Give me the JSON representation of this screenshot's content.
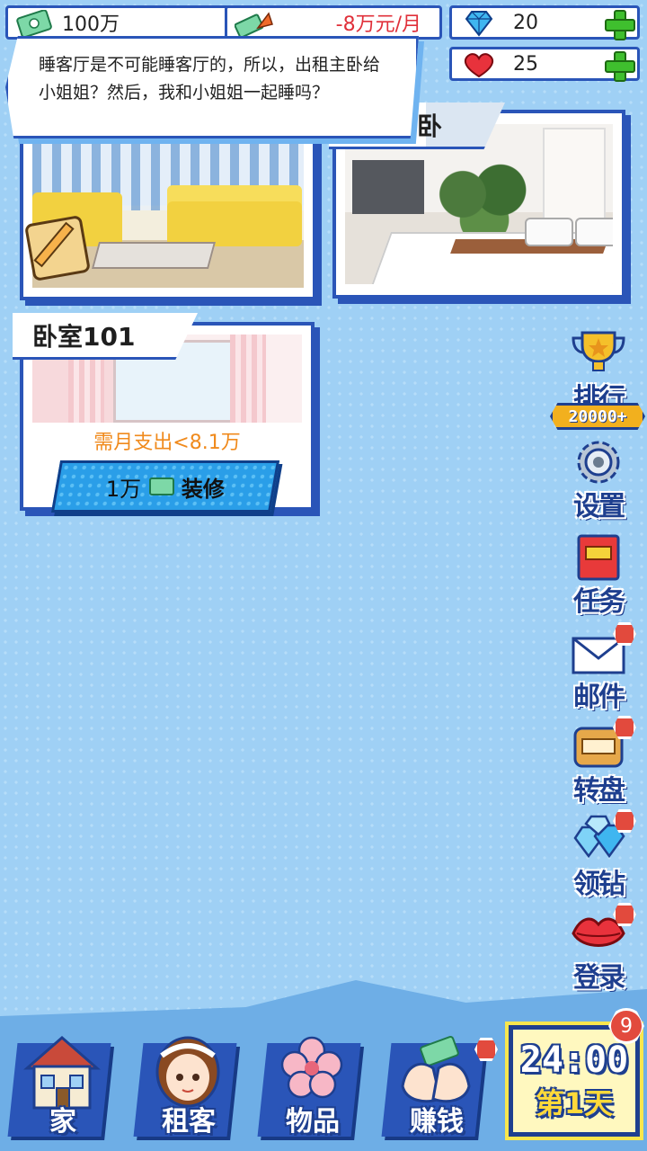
{
  "resources": {
    "money": "100万",
    "income": "-8万元/月",
    "diamonds": "20",
    "hearts": "25"
  },
  "dialog": {
    "text": "睡客厅是不可能睡客厅的，所以，出租主卧给小姐姐？然后，我和小姐姐一起睡吗？"
  },
  "rooms": {
    "living": {
      "label": ""
    },
    "master": {
      "label": "主卧"
    },
    "bedroom101": {
      "label": "卧室101",
      "expense": "需月支出<8.1万",
      "decorate_cost": "1万",
      "decorate_action": "装修"
    }
  },
  "side_menu": {
    "ranking": {
      "label": "排行",
      "sub": "20000+"
    },
    "settings": {
      "label": "设置"
    },
    "tasks": {
      "label": "任务"
    },
    "mail": {
      "label": "邮件"
    },
    "wheel": {
      "label": "转盘"
    },
    "diamonds": {
      "label": "领钻"
    },
    "login": {
      "label": "登录"
    }
  },
  "bottom_nav": {
    "home": "家",
    "tenants": "租客",
    "items": "物品",
    "earn": "赚钱"
  },
  "clock": {
    "time": "24:00",
    "day": "第1天",
    "badge": "9"
  },
  "colors": {
    "accent_blue": "#2a55b8",
    "background": "#9fd0f5",
    "income_red": "#e0303a",
    "expense_orange": "#f08a1c",
    "badge_red": "#e24a3d"
  }
}
